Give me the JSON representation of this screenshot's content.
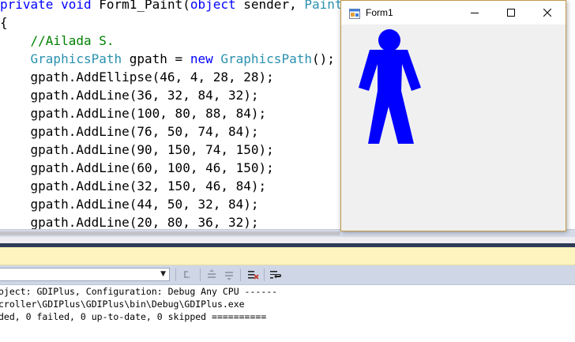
{
  "editor": {
    "lines": [
      [
        {
          "t": "private",
          "c": "kw"
        },
        {
          "t": " "
        },
        {
          "t": "void",
          "c": "kw"
        },
        {
          "t": " Form1_Paint("
        },
        {
          "t": "object",
          "c": "kw"
        },
        {
          "t": " sender, "
        },
        {
          "t": "PaintEv",
          "c": "ty"
        }
      ],
      [
        {
          "t": "{"
        }
      ],
      [
        {
          "t": "    //Ailada S.",
          "c": "cm"
        }
      ],
      [
        {
          "t": "    "
        },
        {
          "t": "GraphicsPath",
          "c": "ty"
        },
        {
          "t": " gpath = "
        },
        {
          "t": "new",
          "c": "kw"
        },
        {
          "t": " "
        },
        {
          "t": "GraphicsPath",
          "c": "ty"
        },
        {
          "t": "();"
        }
      ],
      [
        {
          "t": "    gpath.AddEllipse(46, 4, 28, 28);"
        }
      ],
      [
        {
          "t": "    gpath.AddLine(36, 32, 84, 32);"
        }
      ],
      [
        {
          "t": "    gpath.AddLine(100, 80, 88, 84);"
        }
      ],
      [
        {
          "t": "    gpath.AddLine(76, 50, 74, 84);"
        }
      ],
      [
        {
          "t": "    gpath.AddLine(90, 150, 74, 150);"
        }
      ],
      [
        {
          "t": "    gpath.AddLine(60, 100, 46, 150);"
        }
      ],
      [
        {
          "t": "    gpath.AddLine(32, 150, 46, 84);"
        }
      ],
      [
        {
          "t": "    gpath.AddLine(44, 50, 32, 84);"
        }
      ],
      [
        {
          "t": "    gpath.AddLine(20, 80, 36, 32);"
        }
      ]
    ]
  },
  "output": {
    "source_value": "",
    "lines": [
      "oject: GDIPlus, Configuration: Debug Any CPU ------",
      "croller\\GDIPlus\\GDIPlus\\bin\\Debug\\GDIPlus.exe",
      "ded, 0 failed, 0 up-to-date, 0 skipped =========="
    ]
  },
  "form": {
    "title": "Form1",
    "figure_color": "#0000ff",
    "window_color": "#f0f0f0"
  }
}
